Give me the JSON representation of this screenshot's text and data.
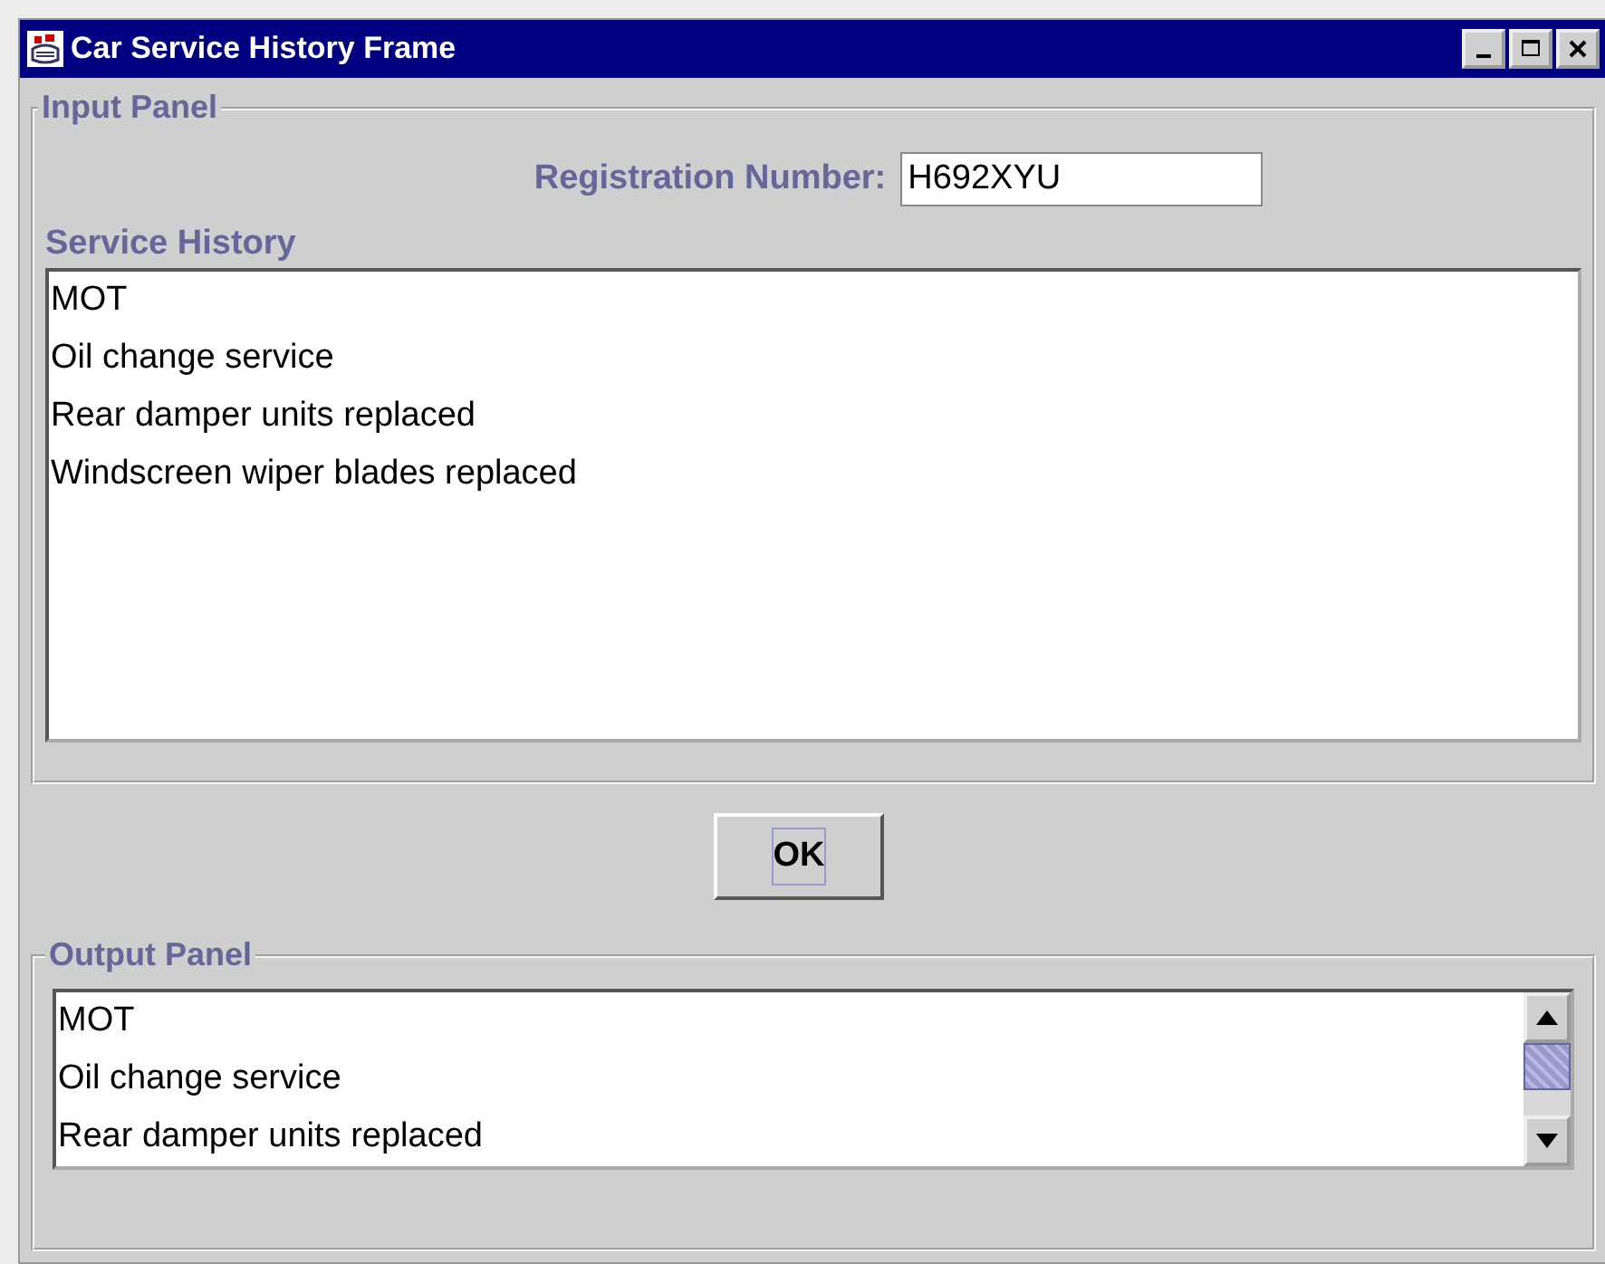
{
  "window": {
    "title": "Car Service History Frame"
  },
  "input_panel": {
    "title": "Input Panel",
    "registration_label": "Registration Number:",
    "registration_value": "H692XYU",
    "history_label": "Service History",
    "history": [
      "MOT",
      "Oil change service",
      "Rear damper units replaced",
      "Windscreen wiper blades replaced"
    ]
  },
  "ok_button": {
    "label": "OK",
    "focused": true
  },
  "output_panel": {
    "title": "Output Panel",
    "lines": [
      "MOT",
      "Oil change service",
      "Rear damper units replaced"
    ]
  }
}
